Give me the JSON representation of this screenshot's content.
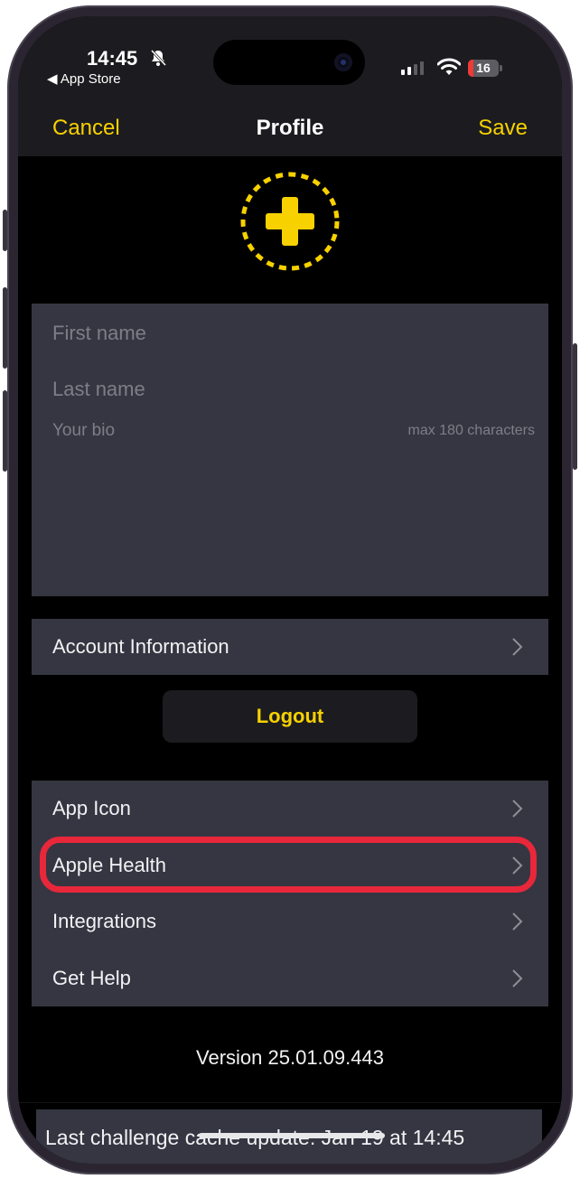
{
  "status_bar": {
    "time": "14:45",
    "back_app": "◀ App Store",
    "battery": "16",
    "silent": true,
    "signal_bars_active": 2,
    "signal_bars_total": 4
  },
  "nav": {
    "cancel": "Cancel",
    "title": "Profile",
    "save": "Save"
  },
  "form": {
    "first_name_placeholder": "First name",
    "last_name_placeholder": "Last name",
    "bio_placeholder": "Your bio",
    "bio_hint": "max 180 characters"
  },
  "account": {
    "label": "Account Information"
  },
  "logout_label": "Logout",
  "settings": {
    "items": [
      {
        "label": "App Icon"
      },
      {
        "label": "Apple Health"
      },
      {
        "label": "Integrations"
      },
      {
        "label": "Get Help"
      }
    ],
    "highlighted": "Apple Health"
  },
  "version": "Version 25.01.09.443",
  "cache_text": "Last challenge cache update: Jan 19 at 14:45",
  "colors": {
    "accent": "#f7d100",
    "highlight": "#e8273b",
    "card": "#353642",
    "background": "#000000"
  }
}
